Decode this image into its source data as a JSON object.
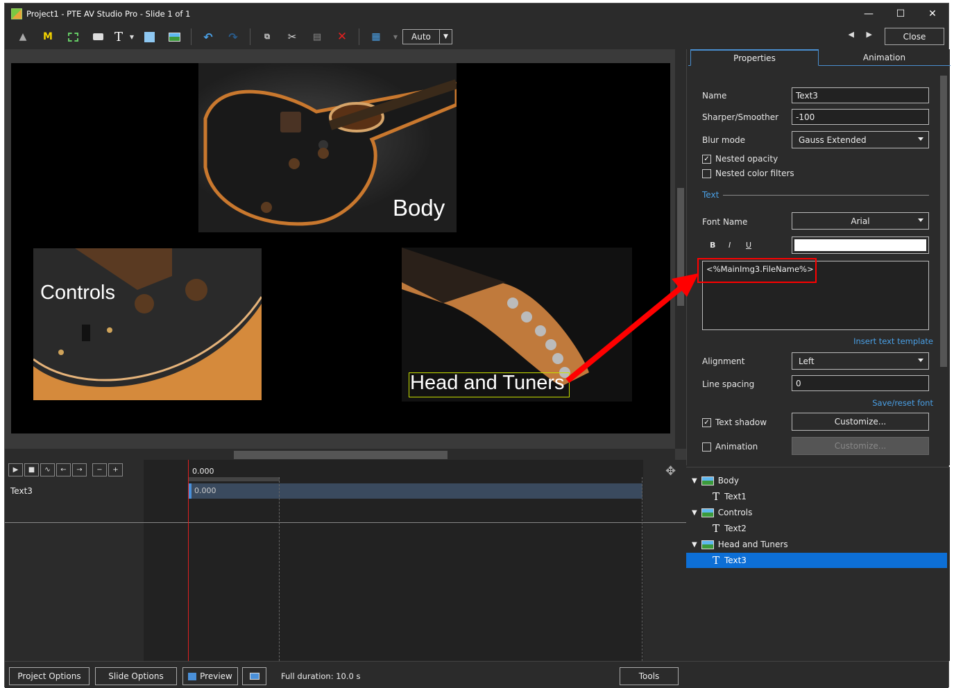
{
  "window": {
    "title": "Project1 - PTE AV Studio Pro - Slide 1 of 1"
  },
  "toolbar": {
    "auto_label": "Auto",
    "close_label": "Close",
    "m_label": "M",
    "t_label": "T"
  },
  "slide": {
    "captions": [
      "Body",
      "Controls",
      "Head and Tuners"
    ]
  },
  "properties": {
    "tabs": [
      "Properties",
      "Animation"
    ],
    "name_label": "Name",
    "name_value": "Text3",
    "sharper_label": "Sharper/Smoother",
    "sharper_value": "-100",
    "blur_label": "Blur mode",
    "blur_value": "Gauss Extended",
    "nested_opacity_label": "Nested opacity",
    "nested_color_label": "Nested color filters",
    "text_section": "Text",
    "font_label": "Font Name",
    "font_value": "Arial",
    "bold": "B",
    "italic": "I",
    "underline": "U",
    "text_content": "<%MainImg3.FileName%>",
    "insert_template": "Insert text template",
    "alignment_label": "Alignment",
    "alignment_value": "Left",
    "line_spacing_label": "Line spacing",
    "line_spacing_value": "0",
    "save_reset_font": "Save/reset font",
    "text_shadow_label": "Text shadow",
    "customize_label": "Customize...",
    "animation_label": "Animation",
    "customize_disabled_label": "Customize..."
  },
  "tree": {
    "items": [
      {
        "label": "Body",
        "type": "image"
      },
      {
        "label": "Text1",
        "type": "text"
      },
      {
        "label": "Controls",
        "type": "image"
      },
      {
        "label": "Text2",
        "type": "text"
      },
      {
        "label": "Head and Tuners",
        "type": "image"
      },
      {
        "label": "Text3",
        "type": "text"
      }
    ]
  },
  "timeline": {
    "time_ruler": "0.000",
    "track_name": "Text3",
    "track_time": "0.000"
  },
  "bottom": {
    "project_options": "Project Options",
    "slide_options": "Slide Options",
    "preview": "Preview",
    "full_duration": "Full duration: 10.0 s",
    "tools": "Tools"
  },
  "colors": {
    "accent": "#0d6fd6",
    "highlight_red": "#ff0000",
    "selection_yellow": "#c8e000"
  }
}
